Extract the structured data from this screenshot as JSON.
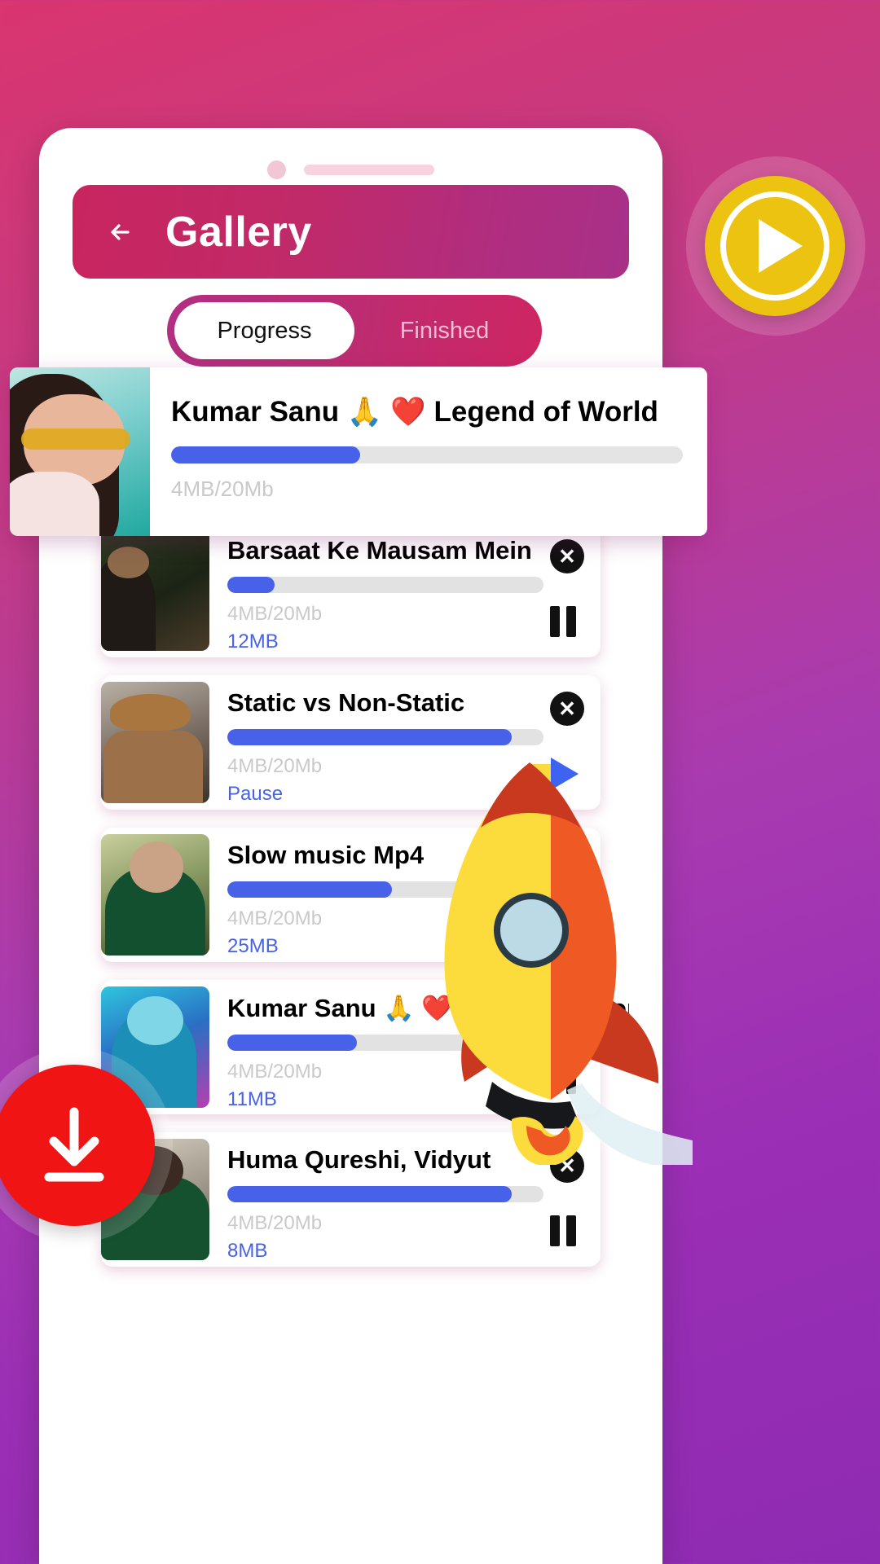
{
  "app": {
    "title": "Gallery",
    "back_icon": "back-arrow-icon"
  },
  "tabs": [
    {
      "label": "Progress",
      "active": true
    },
    {
      "label": "Finished",
      "active": false
    }
  ],
  "featured": {
    "title": "Kumar Sanu 🙏 ❤️ Legend of World",
    "size_text": "4MB/20Mb",
    "progress_percent": 37
  },
  "downloads": [
    {
      "title": "Barsaat Ke Mausam Mein",
      "size_text": "4MB/20Mb",
      "action_text": "12MB",
      "progress_percent": 15,
      "control_icon": "pause-icon",
      "close_icon": "close-icon"
    },
    {
      "title": "Static vs Non-Static",
      "size_text": "4MB/20Mb",
      "action_text": "Pause",
      "progress_percent": 90,
      "control_icon": "play-icon",
      "close_icon": "close-icon"
    },
    {
      "title": "Slow music Mp4",
      "size_text": "4MB/20Mb",
      "action_text": "25MB",
      "progress_percent": 52,
      "control_icon": "pause-icon",
      "close_icon": "close-icon"
    },
    {
      "title": "Kumar Sanu 🙏 ❤️ Legend of World",
      "size_text": "4MB/20Mb",
      "action_text": "11MB",
      "progress_percent": 30,
      "control_icon": "pause-icon",
      "close_icon": "close-icon"
    },
    {
      "title": "Huma Qureshi, Vidyut",
      "size_text": "4MB/20Mb",
      "action_text": "8MB",
      "progress_percent": 90,
      "control_icon": "pause-icon",
      "close_icon": "close-icon"
    }
  ],
  "fabs": {
    "play_label": "play-icon",
    "download_label": "download-icon"
  },
  "colors": {
    "accent_pink": "#c8255f",
    "progress_blue": "#4762e8",
    "play_fab_yellow": "#ecc310",
    "download_fab_red": "#f01414",
    "background_start": "#d9356f",
    "background_end": "#8e2bb2"
  },
  "decor": {
    "rocket": "rocket-illustration"
  }
}
